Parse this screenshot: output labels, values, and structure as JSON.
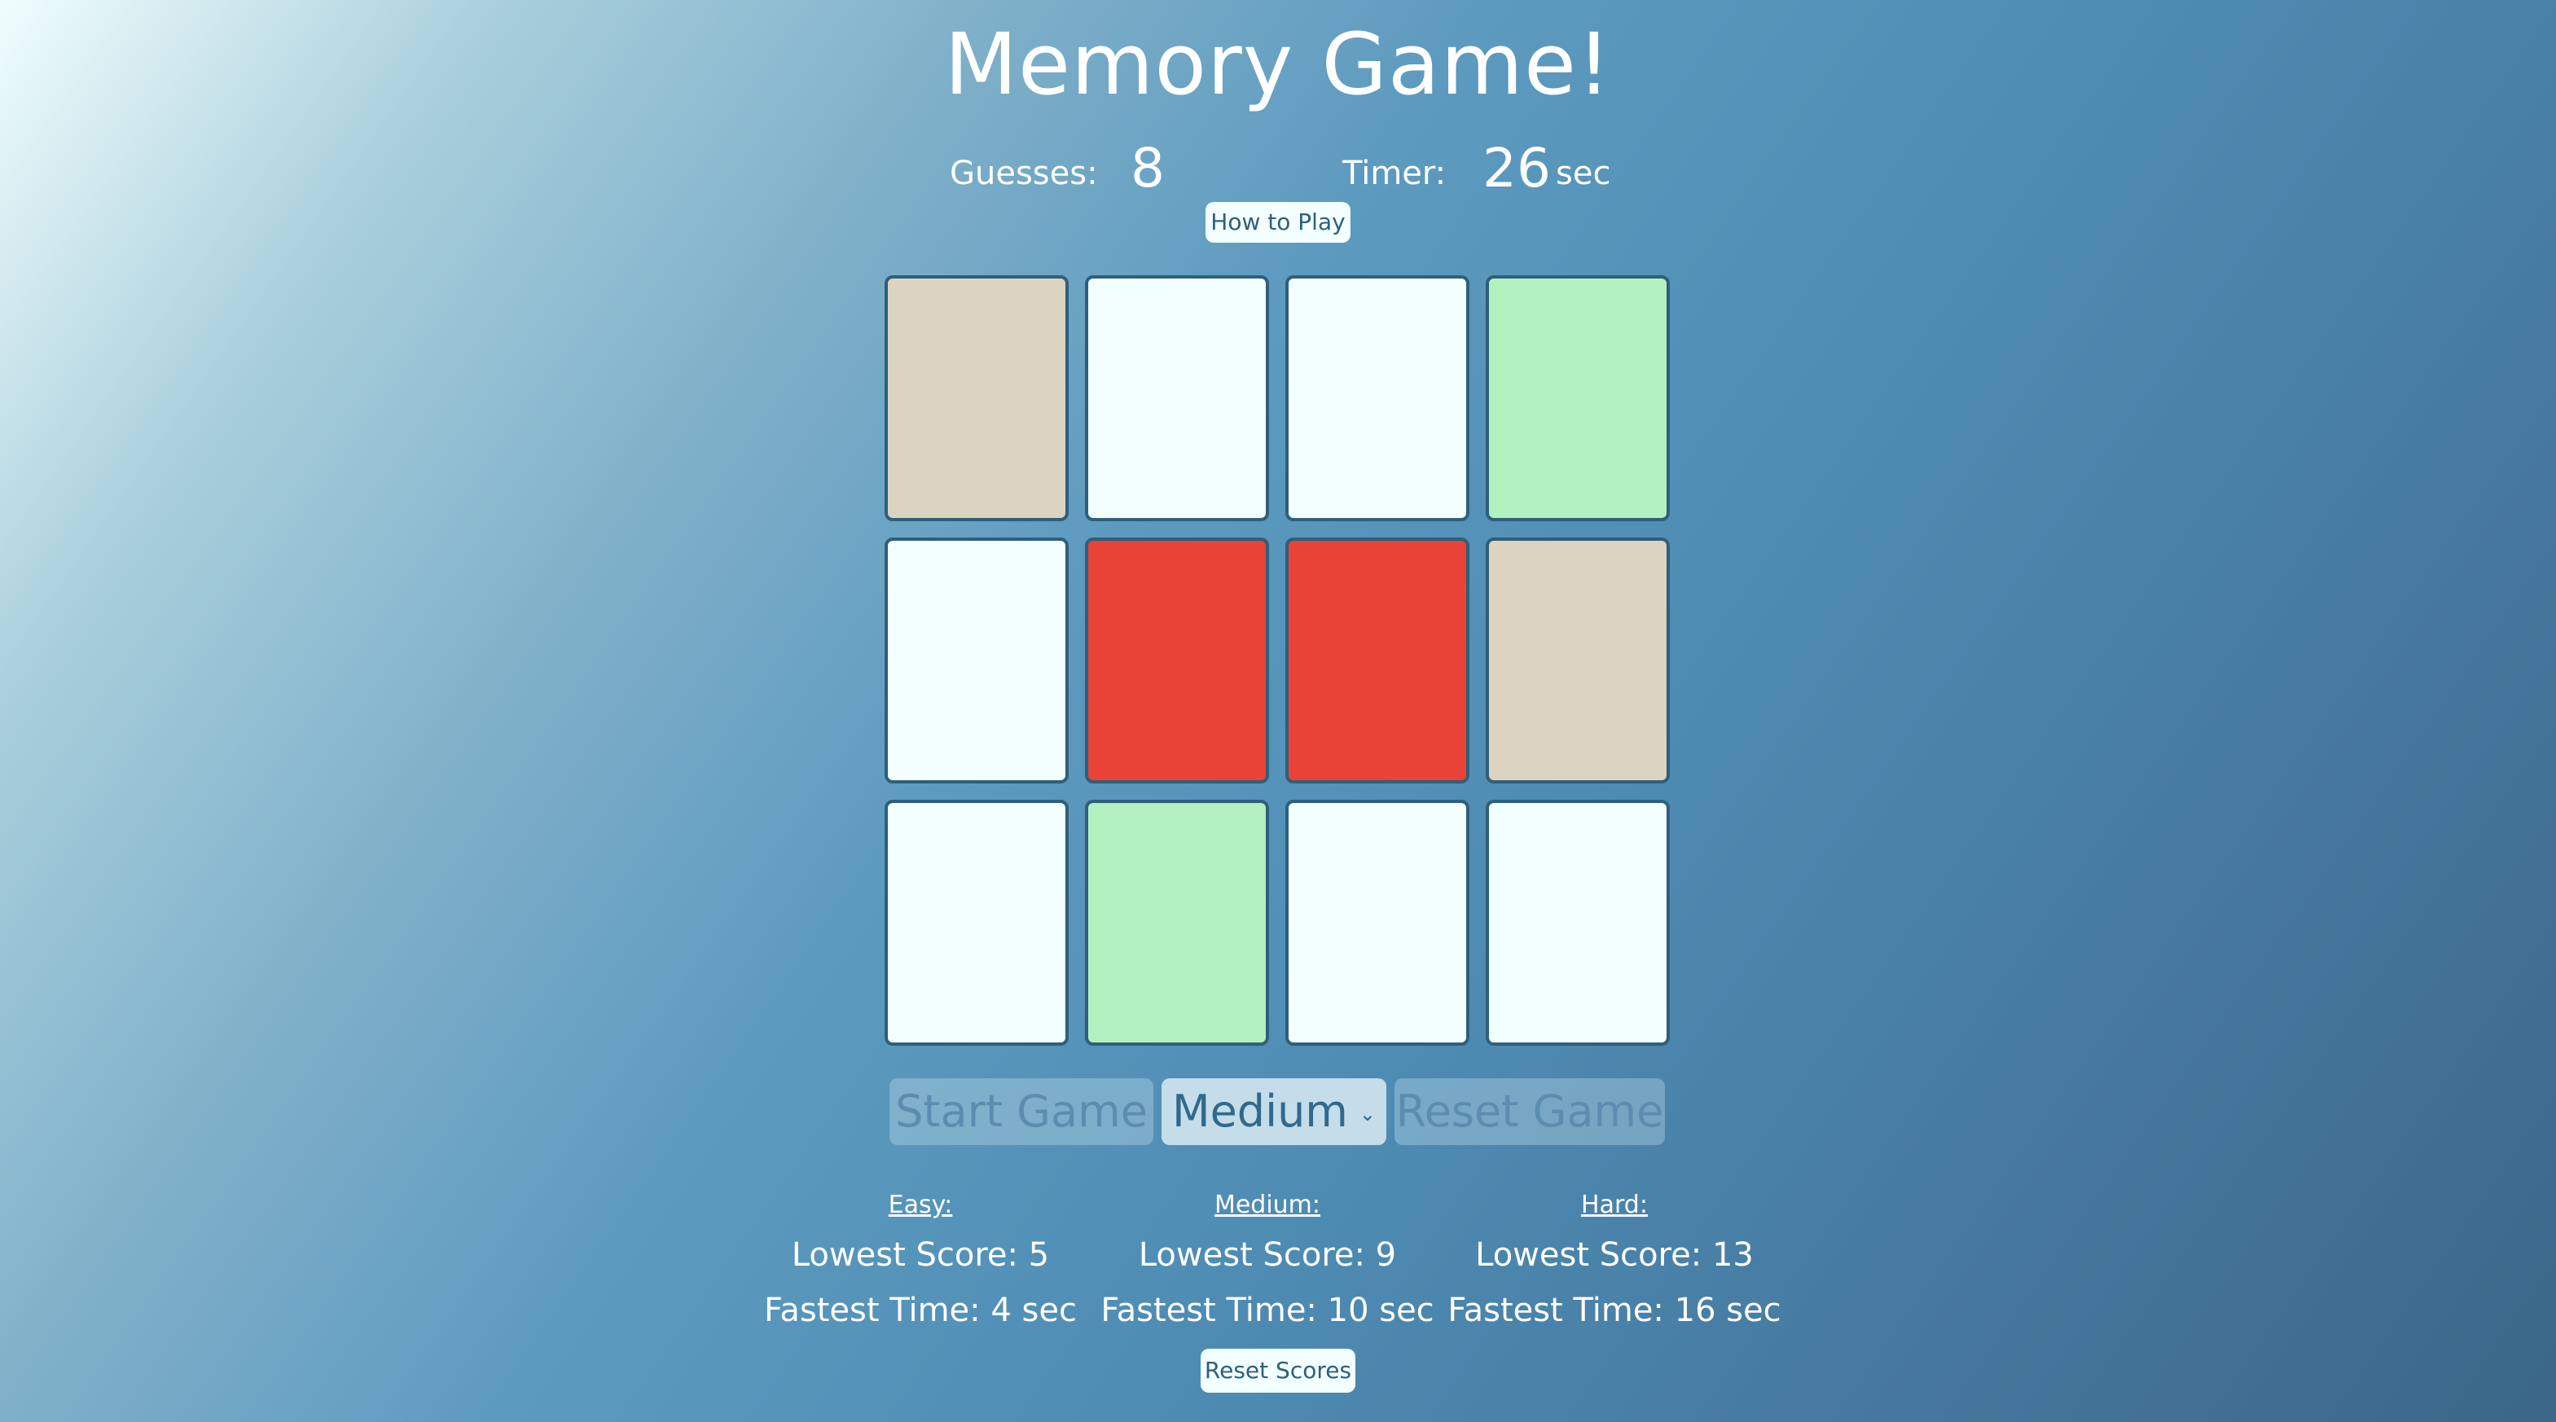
{
  "title": "Memory Game!",
  "stats": {
    "guesses_label": "Guesses:",
    "guesses": "8",
    "timer_label": "Timer:",
    "timer": "26",
    "timer_unit": "sec"
  },
  "how_to_play": "How to Play",
  "colors": {
    "beige": "#dcd4c0",
    "blank": "#f2fffe",
    "green": "#b2f1bf",
    "red": "#e84336",
    "border": "#2f5f7a"
  },
  "cards": [
    "beige",
    "blank",
    "blank",
    "green",
    "blank",
    "red",
    "red",
    "beige",
    "blank",
    "green",
    "blank",
    "blank"
  ],
  "controls": {
    "start": "Start Game",
    "difficulty": "Medium",
    "reset": "Reset Game"
  },
  "scores": [
    {
      "level": "Easy:",
      "lowest": "Lowest Score: 5",
      "fastest": "Fastest Time: 4 sec"
    },
    {
      "level": "Medium:",
      "lowest": "Lowest Score: 9",
      "fastest": "Fastest Time: 10 sec"
    },
    {
      "level": "Hard:",
      "lowest": "Lowest Score: 13",
      "fastest": "Fastest Time: 16 sec"
    }
  ],
  "reset_scores": "Reset Scores"
}
